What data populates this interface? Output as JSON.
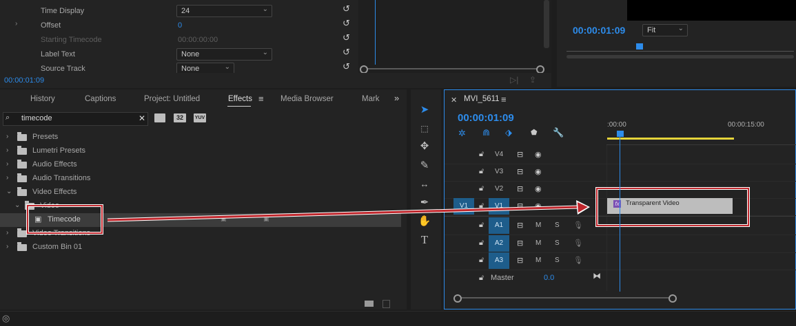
{
  "effect_controls": {
    "rows": [
      {
        "label": "Time Display",
        "value": "24",
        "type": "dropdown"
      },
      {
        "label": "Offset",
        "value": "0",
        "type": "number"
      },
      {
        "label": "Starting Timecode",
        "value": "00:00:00:00",
        "type": "disabled"
      },
      {
        "label": "Label Text",
        "value": "None",
        "type": "dropdown"
      },
      {
        "label": "Source Track",
        "value": "None",
        "type": "dropdown"
      }
    ],
    "timecode": "00:00:01:09"
  },
  "program_monitor": {
    "timecode": "00:00:01:09",
    "zoom": "Fit"
  },
  "effects_panel": {
    "tabs": [
      "History",
      "Captions",
      "Project: Untitled",
      "Effects",
      "Media Browser",
      "Mark"
    ],
    "active_tab": "Effects",
    "search_value": "timecode",
    "badges": [
      "32",
      "YUV"
    ],
    "tree": [
      {
        "label": "Presets"
      },
      {
        "label": "Lumetri Presets"
      },
      {
        "label": "Audio Effects"
      },
      {
        "label": "Audio Transitions"
      },
      {
        "label": "Video Effects",
        "expanded": true
      },
      {
        "label": "Video",
        "expanded": true,
        "obscured": true
      },
      {
        "label": "Timecode",
        "selected": true,
        "effect": true
      },
      {
        "label": "Video Transitions"
      },
      {
        "label": "Custom Bin 01"
      }
    ]
  },
  "timeline": {
    "sequence_name": "MVI_5611",
    "timecode": "00:00:01:09",
    "ruler_labels": [
      ":00:00",
      "00:00:15:00"
    ],
    "video_tracks": [
      "V4",
      "V3",
      "V2",
      "V1"
    ],
    "source_patch": "V1",
    "audio_tracks": [
      "A1",
      "A2",
      "A3"
    ],
    "mute_label": "M",
    "solo_label": "S",
    "master_label": "Master",
    "master_value": "0.0",
    "clip_label": "Transparent Video",
    "fx_badge": "fx"
  },
  "colors": {
    "accent": "#2d8ceb",
    "highlight_box": "#c0262c",
    "clip": "#bdbdbd",
    "target": "#1e5d8b",
    "work_area": "#e5d43a"
  }
}
